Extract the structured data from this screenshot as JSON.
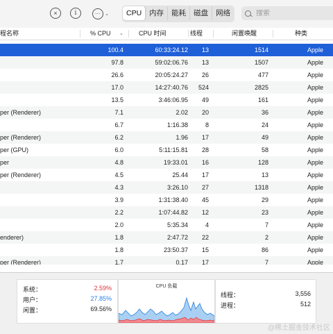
{
  "toolbar": {
    "close_icon": "×",
    "info_icon": "i",
    "more_icon": "···",
    "chevron": "⌄",
    "tabs": [
      {
        "label": "CPU",
        "active": true
      },
      {
        "label": "内存",
        "active": false
      },
      {
        "label": "能耗",
        "active": false
      },
      {
        "label": "磁盘",
        "active": false
      },
      {
        "label": "网络",
        "active": false
      }
    ],
    "search_placeholder": "搜索"
  },
  "table": {
    "columns": {
      "name": "程名称",
      "cpu": "% CPU",
      "time": "CPU 时间",
      "threads": "线程",
      "wakes": "闲置唤醒",
      "kind": "种类"
    },
    "sort_indicator": "⌄",
    "rows": [
      {
        "name": "",
        "cpu": "100.4",
        "time": "60:33:24.12",
        "threads": "13",
        "wakes": "1514",
        "kind": "Apple",
        "selected": true
      },
      {
        "name": "",
        "cpu": "97.8",
        "time": "59:02:06.76",
        "threads": "13",
        "wakes": "1507",
        "kind": "Apple"
      },
      {
        "name": "",
        "cpu": "26.6",
        "time": "20:05:24.27",
        "threads": "26",
        "wakes": "477",
        "kind": "Apple"
      },
      {
        "name": "",
        "cpu": "17.0",
        "time": "14:27:40.76",
        "threads": "524",
        "wakes": "2825",
        "kind": "Apple"
      },
      {
        "name": "",
        "cpu": "13.5",
        "time": "3:46:06.95",
        "threads": "49",
        "wakes": "161",
        "kind": "Apple"
      },
      {
        "name": "per (Renderer)",
        "cpu": "7.1",
        "time": "2.02",
        "threads": "20",
        "wakes": "36",
        "kind": "Apple"
      },
      {
        "name": "",
        "cpu": "6.7",
        "time": "1:16.38",
        "threads": "8",
        "wakes": "24",
        "kind": "Apple"
      },
      {
        "name": "per (Renderer)",
        "cpu": "6.2",
        "time": "1.96",
        "threads": "17",
        "wakes": "49",
        "kind": "Apple"
      },
      {
        "name": "per (GPU)",
        "cpu": "6.0",
        "time": "5:11:15.81",
        "threads": "28",
        "wakes": "58",
        "kind": "Apple"
      },
      {
        "name": "per",
        "cpu": "4.8",
        "time": "19:33.01",
        "threads": "16",
        "wakes": "128",
        "kind": "Apple"
      },
      {
        "name": "per (Renderer)",
        "cpu": "4.5",
        "time": "25.44",
        "threads": "17",
        "wakes": "13",
        "kind": "Apple"
      },
      {
        "name": "",
        "cpu": "4.3",
        "time": "3:26.10",
        "threads": "27",
        "wakes": "1318",
        "kind": "Apple"
      },
      {
        "name": "",
        "cpu": "3.9",
        "time": "1:31:38.40",
        "threads": "45",
        "wakes": "29",
        "kind": "Apple"
      },
      {
        "name": "",
        "cpu": "2.2",
        "time": "1:07:44.82",
        "threads": "12",
        "wakes": "23",
        "kind": "Apple"
      },
      {
        "name": "",
        "cpu": "2.0",
        "time": "5:35.34",
        "threads": "4",
        "wakes": "7",
        "kind": "Apple"
      },
      {
        "name": "enderer)",
        "cpu": "1.8",
        "time": "2:47.72",
        "threads": "22",
        "wakes": "2",
        "kind": "Apple"
      },
      {
        "name": "",
        "cpu": "1.8",
        "time": "23:50.37",
        "threads": "15",
        "wakes": "86",
        "kind": "Apple"
      },
      {
        "name": "per (Renderer)",
        "cpu": "1.7",
        "time": "0.17",
        "threads": "17",
        "wakes": "7",
        "kind": "Apple"
      }
    ]
  },
  "summary": {
    "system_label": "系统：",
    "system_value": "2.59%",
    "user_label": "用户：",
    "user_value": "27.85%",
    "idle_label": "闲置：",
    "idle_value": "69.56%",
    "graph_title": "CPU 负载",
    "threads_label": "线程：",
    "threads_value": "3,556",
    "processes_label": "进程：",
    "processes_value": "512",
    "colors": {
      "system": "#e0303a",
      "user": "#2a7fe0",
      "user_fill": "#a9d0f2",
      "system_fill": "#f08a90"
    }
  },
  "watermark": "@稀土掘金技术社区"
}
